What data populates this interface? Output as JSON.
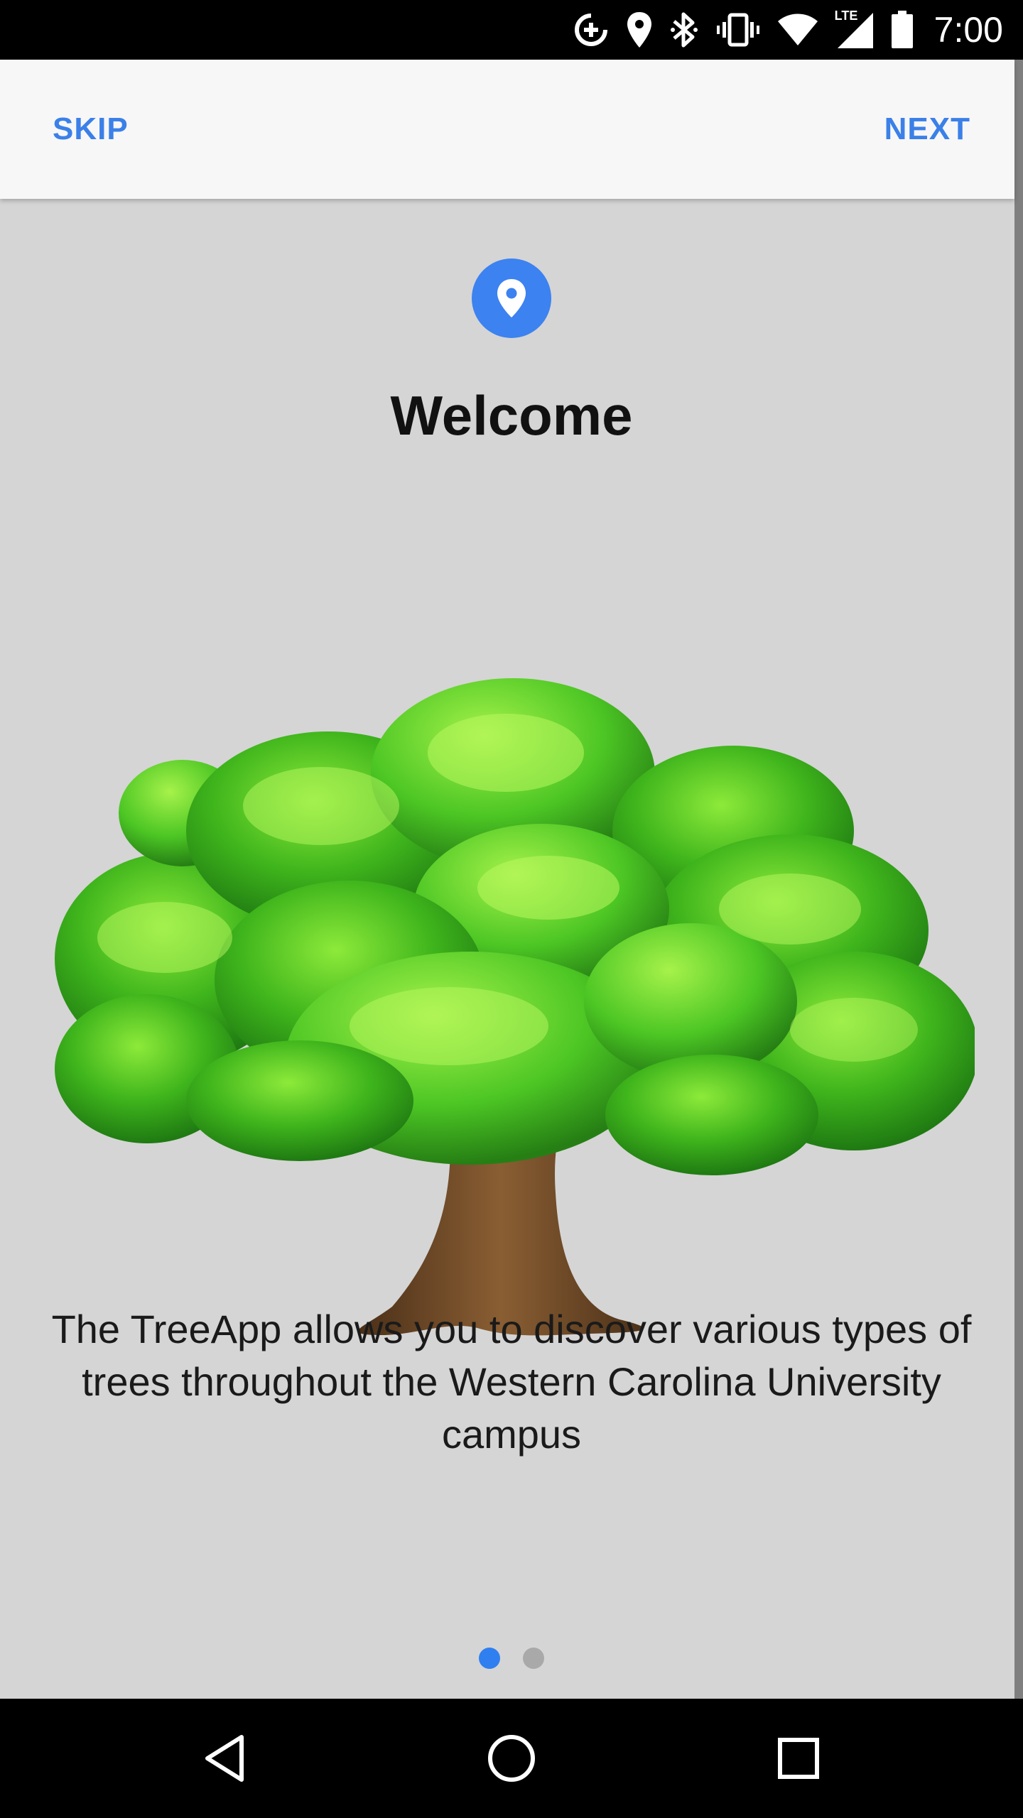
{
  "status_bar": {
    "time": "7:00",
    "lte_label": "LTE",
    "icons": [
      "data-saver-icon",
      "location-icon",
      "bluetooth-icon",
      "vibrate-icon",
      "wifi-icon",
      "lte-signal-icon",
      "battery-icon"
    ]
  },
  "toolbar": {
    "skip_label": "SKIP",
    "next_label": "NEXT",
    "accent_color": "#3b80e8"
  },
  "onboarding": {
    "icon": "location-pin-icon",
    "title": "Welcome",
    "image": "tree-illustration",
    "description": "The TreeApp allows you to discover various types of trees throughout the Western Carolina University campus",
    "pages_total": 2,
    "current_page": 1
  },
  "nav_bar": {
    "buttons": [
      "back-icon",
      "home-icon",
      "recents-icon"
    ]
  }
}
